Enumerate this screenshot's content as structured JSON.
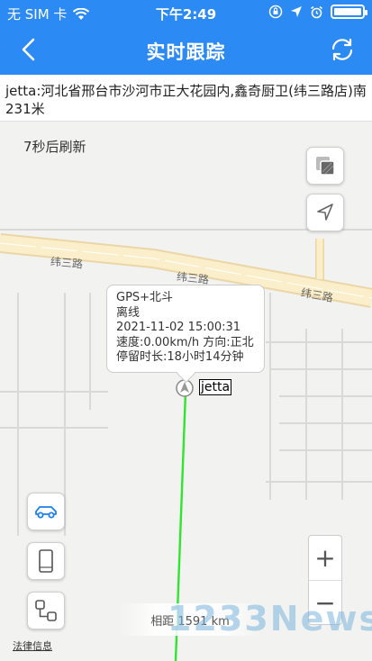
{
  "status_bar": {
    "carrier": "无 SIM 卡",
    "time": "下午2:49"
  },
  "nav": {
    "title": "实时跟踪",
    "back_icon": "chevron-left-icon",
    "refresh_icon": "refresh-icon"
  },
  "address": {
    "text": "jetta:河北省邢台市沙河市正大花园内,鑫奇厨卫(纬三路店)南231米"
  },
  "map": {
    "refresh_countdown": "7秒后刷新",
    "road_label": "纬三路",
    "popup": {
      "line1": "GPS+北斗",
      "line2": "离线",
      "line3": "2021-11-02 15:00:31",
      "line4": "速度:0.00km/h 方向:正北",
      "line5": "停留时长:18小时14分钟"
    },
    "vehicle_label": "jetta",
    "zoom_in": "+",
    "zoom_out": "−",
    "distance": "相距 1591 km",
    "legal": "法律信息",
    "watermark": "1233News",
    "track_color": "#2ee62e"
  },
  "colors": {
    "header": "#2b8af4",
    "accent": "#1e7ee8"
  }
}
